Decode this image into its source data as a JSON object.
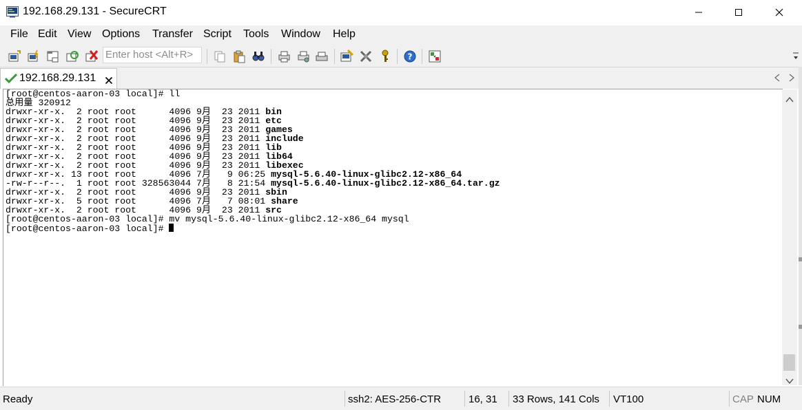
{
  "window": {
    "title": "192.168.29.131 - SecureCRT",
    "icons": {
      "app": "securecrt-app-icon",
      "minimize": "minimize-icon",
      "maximize": "maximize-icon",
      "close": "close-icon"
    }
  },
  "menu": {
    "items": [
      "File",
      "Edit",
      "View",
      "Options",
      "Transfer",
      "Script",
      "Tools",
      "Window",
      "Help"
    ]
  },
  "toolbar": {
    "host_placeholder": "Enter host <Alt+R>",
    "icons": [
      "connect-icon",
      "quick-connect-icon",
      "connect-in-tab-icon",
      "reconnect-icon",
      "disconnect-icon",
      "copy-icon",
      "paste-icon",
      "find-icon",
      "print-icon",
      "print-setup-icon",
      "print-selection-icon",
      "session-options-icon",
      "global-options-icon",
      "key-map-icon",
      "help-icon",
      "sftp-icon"
    ]
  },
  "tabs": [
    {
      "label": "192.168.29.131",
      "status_icon": "connected-check-icon",
      "active": true
    }
  ],
  "terminal": {
    "rows": 33,
    "cols": 141,
    "lines": [
      {
        "plain": "[root@centos-aaron-03 local]# ll",
        "bold": ""
      },
      {
        "plain": "总用量 320912",
        "bold": ""
      },
      {
        "plain": "drwxr-xr-x.  2 root root      4096 9月  23 2011 ",
        "bold": "bin"
      },
      {
        "plain": "drwxr-xr-x.  2 root root      4096 9月  23 2011 ",
        "bold": "etc"
      },
      {
        "plain": "drwxr-xr-x.  2 root root      4096 9月  23 2011 ",
        "bold": "games"
      },
      {
        "plain": "drwxr-xr-x.  2 root root      4096 9月  23 2011 ",
        "bold": "include"
      },
      {
        "plain": "drwxr-xr-x.  2 root root      4096 9月  23 2011 ",
        "bold": "lib"
      },
      {
        "plain": "drwxr-xr-x.  2 root root      4096 9月  23 2011 ",
        "bold": "lib64"
      },
      {
        "plain": "drwxr-xr-x.  2 root root      4096 9月  23 2011 ",
        "bold": "libexec"
      },
      {
        "plain": "drwxr-xr-x. 13 root root      4096 7月   9 06:25 ",
        "bold": "mysql-5.6.40-linux-glibc2.12-x86_64"
      },
      {
        "plain": "-rw-r--r--.  1 root root 328563044 7月   8 21:54 ",
        "bold": "mysql-5.6.40-linux-glibc2.12-x86_64.tar.gz"
      },
      {
        "plain": "drwxr-xr-x.  2 root root      4096 9月  23 2011 ",
        "bold": "sbin"
      },
      {
        "plain": "drwxr-xr-x.  5 root root      4096 7月   7 08:01 ",
        "bold": "share"
      },
      {
        "plain": "drwxr-xr-x.  2 root root      4096 9月  23 2011 ",
        "bold": "src"
      },
      {
        "plain": "[root@centos-aaron-03 local]# mv mysql-5.6.40-linux-glibc2.12-x86_64 mysql",
        "bold": ""
      },
      {
        "plain": "[root@centos-aaron-03 local]# ",
        "bold": ""
      }
    ]
  },
  "status": {
    "ready": "Ready",
    "protocol": "ssh2: AES-256-CTR",
    "cursor_pos": "16,  31",
    "size": "33 Rows, 141 Cols",
    "emulation": "VT100",
    "cap": "CAP",
    "num": "NUM"
  },
  "colors": {
    "chrome": "#f0f0f0",
    "terminal_bg": "#ffffff",
    "terminal_fg": "#000000",
    "tab_check": "#3a9a3a",
    "dim_text": "#808080"
  }
}
